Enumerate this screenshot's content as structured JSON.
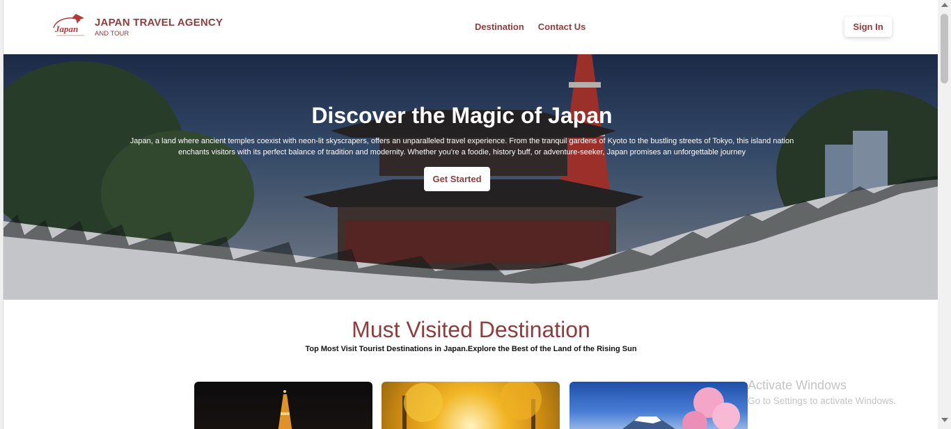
{
  "header": {
    "brand_title": "JAPAN TRAVEL AGENCY",
    "brand_sub": "AND TOUR",
    "logo_text": "Japan",
    "nav": [
      {
        "label": "Destination"
      },
      {
        "label": "Contact Us"
      }
    ],
    "signin_label": "Sign In"
  },
  "hero": {
    "title": "Discover the Magic of Japan",
    "description": "Japan, a land where ancient temples coexist with neon-lit skyscrapers, offers an unparalleled travel experience. From the tranquil gardens of Kyoto to the bustling streets of Tokyo, this island nation enchants visitors with its perfect balance of tradition and modernity. Whether you're a foodie, history buff, or adventure-seeker, Japan promises an unforgettable journey",
    "cta_label": "Get Started"
  },
  "destinations": {
    "title": "Must Visited Destination",
    "subtitle": "Top Most Visit Tourist Destinations in Japan.Explore the Best of the Land of the Rising Sun"
  },
  "watermark": {
    "title": "Activate Windows",
    "subtitle": "Go to Settings to activate Windows."
  },
  "colors": {
    "accent": "#8d3d3d"
  }
}
